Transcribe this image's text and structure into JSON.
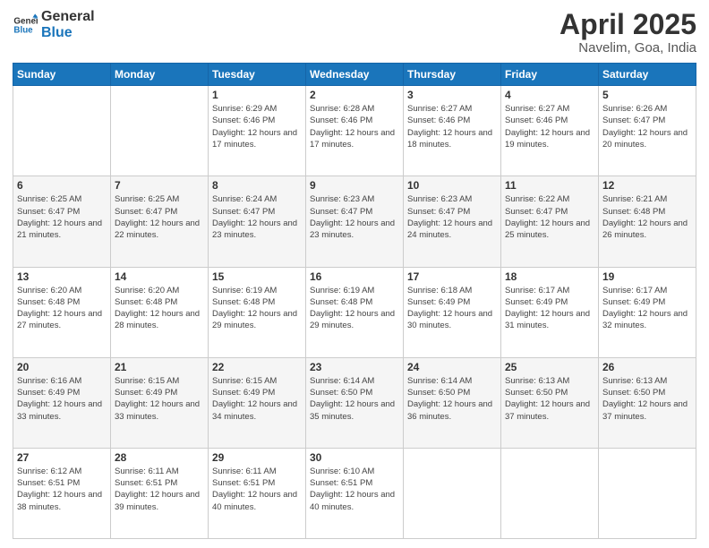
{
  "header": {
    "logo_line1": "General",
    "logo_line2": "Blue",
    "title": "April 2025",
    "subtitle": "Navelim, Goa, India"
  },
  "weekdays": [
    "Sunday",
    "Monday",
    "Tuesday",
    "Wednesday",
    "Thursday",
    "Friday",
    "Saturday"
  ],
  "weeks": [
    [
      {
        "day": "",
        "info": ""
      },
      {
        "day": "",
        "info": ""
      },
      {
        "day": "1",
        "info": "Sunrise: 6:29 AM\nSunset: 6:46 PM\nDaylight: 12 hours and 17 minutes."
      },
      {
        "day": "2",
        "info": "Sunrise: 6:28 AM\nSunset: 6:46 PM\nDaylight: 12 hours and 17 minutes."
      },
      {
        "day": "3",
        "info": "Sunrise: 6:27 AM\nSunset: 6:46 PM\nDaylight: 12 hours and 18 minutes."
      },
      {
        "day": "4",
        "info": "Sunrise: 6:27 AM\nSunset: 6:46 PM\nDaylight: 12 hours and 19 minutes."
      },
      {
        "day": "5",
        "info": "Sunrise: 6:26 AM\nSunset: 6:47 PM\nDaylight: 12 hours and 20 minutes."
      }
    ],
    [
      {
        "day": "6",
        "info": "Sunrise: 6:25 AM\nSunset: 6:47 PM\nDaylight: 12 hours and 21 minutes."
      },
      {
        "day": "7",
        "info": "Sunrise: 6:25 AM\nSunset: 6:47 PM\nDaylight: 12 hours and 22 minutes."
      },
      {
        "day": "8",
        "info": "Sunrise: 6:24 AM\nSunset: 6:47 PM\nDaylight: 12 hours and 23 minutes."
      },
      {
        "day": "9",
        "info": "Sunrise: 6:23 AM\nSunset: 6:47 PM\nDaylight: 12 hours and 23 minutes."
      },
      {
        "day": "10",
        "info": "Sunrise: 6:23 AM\nSunset: 6:47 PM\nDaylight: 12 hours and 24 minutes."
      },
      {
        "day": "11",
        "info": "Sunrise: 6:22 AM\nSunset: 6:47 PM\nDaylight: 12 hours and 25 minutes."
      },
      {
        "day": "12",
        "info": "Sunrise: 6:21 AM\nSunset: 6:48 PM\nDaylight: 12 hours and 26 minutes."
      }
    ],
    [
      {
        "day": "13",
        "info": "Sunrise: 6:20 AM\nSunset: 6:48 PM\nDaylight: 12 hours and 27 minutes."
      },
      {
        "day": "14",
        "info": "Sunrise: 6:20 AM\nSunset: 6:48 PM\nDaylight: 12 hours and 28 minutes."
      },
      {
        "day": "15",
        "info": "Sunrise: 6:19 AM\nSunset: 6:48 PM\nDaylight: 12 hours and 29 minutes."
      },
      {
        "day": "16",
        "info": "Sunrise: 6:19 AM\nSunset: 6:48 PM\nDaylight: 12 hours and 29 minutes."
      },
      {
        "day": "17",
        "info": "Sunrise: 6:18 AM\nSunset: 6:49 PM\nDaylight: 12 hours and 30 minutes."
      },
      {
        "day": "18",
        "info": "Sunrise: 6:17 AM\nSunset: 6:49 PM\nDaylight: 12 hours and 31 minutes."
      },
      {
        "day": "19",
        "info": "Sunrise: 6:17 AM\nSunset: 6:49 PM\nDaylight: 12 hours and 32 minutes."
      }
    ],
    [
      {
        "day": "20",
        "info": "Sunrise: 6:16 AM\nSunset: 6:49 PM\nDaylight: 12 hours and 33 minutes."
      },
      {
        "day": "21",
        "info": "Sunrise: 6:15 AM\nSunset: 6:49 PM\nDaylight: 12 hours and 33 minutes."
      },
      {
        "day": "22",
        "info": "Sunrise: 6:15 AM\nSunset: 6:49 PM\nDaylight: 12 hours and 34 minutes."
      },
      {
        "day": "23",
        "info": "Sunrise: 6:14 AM\nSunset: 6:50 PM\nDaylight: 12 hours and 35 minutes."
      },
      {
        "day": "24",
        "info": "Sunrise: 6:14 AM\nSunset: 6:50 PM\nDaylight: 12 hours and 36 minutes."
      },
      {
        "day": "25",
        "info": "Sunrise: 6:13 AM\nSunset: 6:50 PM\nDaylight: 12 hours and 37 minutes."
      },
      {
        "day": "26",
        "info": "Sunrise: 6:13 AM\nSunset: 6:50 PM\nDaylight: 12 hours and 37 minutes."
      }
    ],
    [
      {
        "day": "27",
        "info": "Sunrise: 6:12 AM\nSunset: 6:51 PM\nDaylight: 12 hours and 38 minutes."
      },
      {
        "day": "28",
        "info": "Sunrise: 6:11 AM\nSunset: 6:51 PM\nDaylight: 12 hours and 39 minutes."
      },
      {
        "day": "29",
        "info": "Sunrise: 6:11 AM\nSunset: 6:51 PM\nDaylight: 12 hours and 40 minutes."
      },
      {
        "day": "30",
        "info": "Sunrise: 6:10 AM\nSunset: 6:51 PM\nDaylight: 12 hours and 40 minutes."
      },
      {
        "day": "",
        "info": ""
      },
      {
        "day": "",
        "info": ""
      },
      {
        "day": "",
        "info": ""
      }
    ]
  ]
}
